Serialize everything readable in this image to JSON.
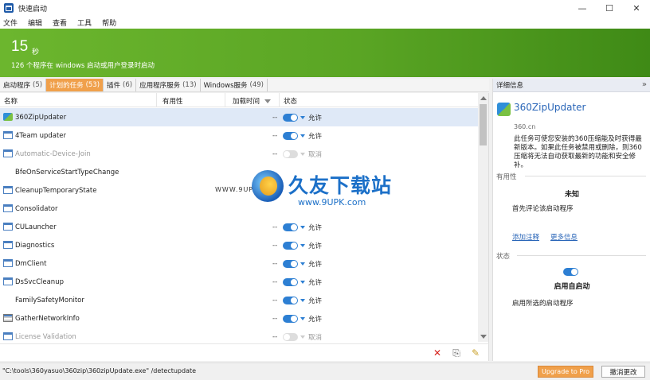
{
  "window": {
    "title": "快速启动",
    "controls": [
      "—",
      "☐",
      "✕"
    ]
  },
  "menu": [
    "文件",
    "编辑",
    "查看",
    "工具",
    "帮助"
  ],
  "banner": {
    "count": "15",
    "unit": "秒",
    "description": "126 个程序在 windows 启动或用户登录时启动"
  },
  "tabs": [
    {
      "label": "启动程序",
      "count": "(5)",
      "active": false
    },
    {
      "label": "计划的任务",
      "count": "(53)",
      "active": true
    },
    {
      "label": "插件",
      "count": "(6)",
      "active": false
    },
    {
      "label": "应用程序服务",
      "count": "(13)",
      "active": false
    },
    {
      "label": "Windows服务",
      "count": "(49)",
      "active": false
    }
  ],
  "columns": {
    "name": "名称",
    "usefulness": "有用性",
    "delay": "加载时间",
    "state": "状态"
  },
  "rows": [
    {
      "name": "360ZipUpdater",
      "dash": "--",
      "state": "允许",
      "on": true,
      "icon": "app-icon",
      "selected": true,
      "dim": false
    },
    {
      "name": "4Team updater",
      "dash": "--",
      "state": "允许",
      "on": true,
      "icon": "task-icon",
      "selected": false,
      "dim": false
    },
    {
      "name": "Automatic-Device-Join",
      "dash": "--",
      "state": "取消",
      "on": false,
      "icon": "task-icon",
      "selected": false,
      "dim": true
    },
    {
      "name": "BfeOnServiceStartTypeChange",
      "dash": "",
      "state": "",
      "on": null,
      "icon": "none",
      "selected": false,
      "dim": false
    },
    {
      "name": "CleanupTemporaryState",
      "dash": "",
      "state": "",
      "on": null,
      "icon": "task-icon",
      "selected": false,
      "dim": false
    },
    {
      "name": "Consolidator",
      "dash": "",
      "state": "",
      "on": null,
      "icon": "task-icon",
      "selected": false,
      "dim": false
    },
    {
      "name": "CULauncher",
      "dash": "--",
      "state": "允许",
      "on": true,
      "icon": "task-icon",
      "selected": false,
      "dim": false
    },
    {
      "name": "Diagnostics",
      "dash": "--",
      "state": "允许",
      "on": true,
      "icon": "task-icon",
      "selected": false,
      "dim": false
    },
    {
      "name": "DmClient",
      "dash": "--",
      "state": "允许",
      "on": true,
      "icon": "task-icon",
      "selected": false,
      "dim": false
    },
    {
      "name": "DsSvcCleanup",
      "dash": "--",
      "state": "允许",
      "on": true,
      "icon": "task-icon",
      "selected": false,
      "dim": false
    },
    {
      "name": "FamilySafetyMonitor",
      "dash": "--",
      "state": "允许",
      "on": true,
      "icon": "none",
      "selected": false,
      "dim": false
    },
    {
      "name": "GatherNetworkInfo",
      "dash": "--",
      "state": "允许",
      "on": true,
      "icon": "network-icon",
      "selected": false,
      "dim": false
    },
    {
      "name": "License Validation",
      "dash": "--",
      "state": "取消",
      "on": false,
      "icon": "task-icon",
      "selected": false,
      "dim": true
    }
  ],
  "toolbar": {
    "delete": "✕",
    "add": "⎘",
    "edit": "✎"
  },
  "detail": {
    "header": "详细信息",
    "collapse": "»",
    "app_name": "360ZipUpdater",
    "publisher": "360.cn",
    "description": "此任务可使您安装的360压缩能及时获得最新版本。如果此任务被禁用或删除，则360压缩将无法自动获取最新的功能和安全修补。",
    "usefulness_title": "有用性",
    "usefulness_value": "未知",
    "usefulness_hint": "首先评论该启动程序",
    "link_add_note": "添加注释",
    "link_more_info": "更多信息",
    "state_title": "状态",
    "state_value": "启用自启动",
    "state_hint": "启用所选的启动程序"
  },
  "status": {
    "path": "\"C:\\tools\\360yasuo\\360zip\\360zipUpdate.exe\" /detectupdate",
    "upgrade": "Upgrade to Pro",
    "cancel": "撤消更改"
  },
  "watermark": {
    "title": "久友下载站",
    "url": "www.9UPK.com",
    "small": "WWW.9UPK."
  },
  "colors": {
    "banner": "#5aa524",
    "accent": "#f0a04b",
    "toggle": "#2d7fd3",
    "link": "#2a66b8"
  }
}
